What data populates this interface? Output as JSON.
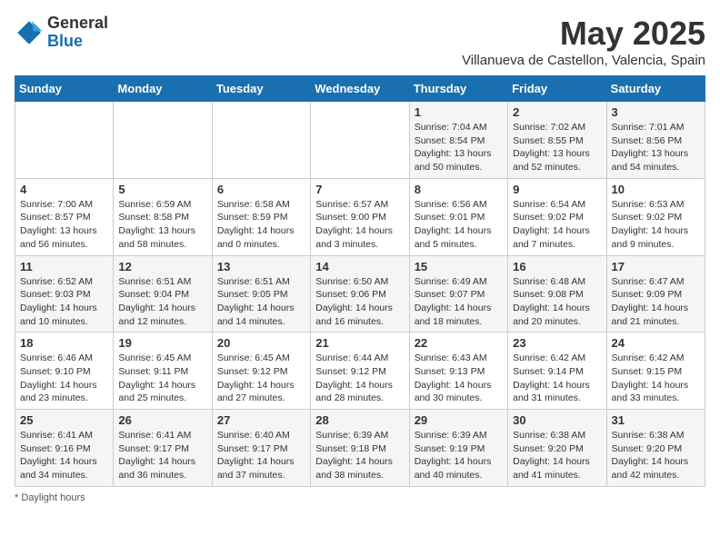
{
  "header": {
    "logo_general": "General",
    "logo_blue": "Blue",
    "month_title": "May 2025",
    "subtitle": "Villanueva de Castellon, Valencia, Spain"
  },
  "days_of_week": [
    "Sunday",
    "Monday",
    "Tuesday",
    "Wednesday",
    "Thursday",
    "Friday",
    "Saturday"
  ],
  "footer": {
    "note": "Daylight hours"
  },
  "weeks": [
    [
      {
        "day": "",
        "info": ""
      },
      {
        "day": "",
        "info": ""
      },
      {
        "day": "",
        "info": ""
      },
      {
        "day": "",
        "info": ""
      },
      {
        "day": "1",
        "info": "Sunrise: 7:04 AM\nSunset: 8:54 PM\nDaylight: 13 hours\nand 50 minutes."
      },
      {
        "day": "2",
        "info": "Sunrise: 7:02 AM\nSunset: 8:55 PM\nDaylight: 13 hours\nand 52 minutes."
      },
      {
        "day": "3",
        "info": "Sunrise: 7:01 AM\nSunset: 8:56 PM\nDaylight: 13 hours\nand 54 minutes."
      }
    ],
    [
      {
        "day": "4",
        "info": "Sunrise: 7:00 AM\nSunset: 8:57 PM\nDaylight: 13 hours\nand 56 minutes."
      },
      {
        "day": "5",
        "info": "Sunrise: 6:59 AM\nSunset: 8:58 PM\nDaylight: 13 hours\nand 58 minutes."
      },
      {
        "day": "6",
        "info": "Sunrise: 6:58 AM\nSunset: 8:59 PM\nDaylight: 14 hours\nand 0 minutes."
      },
      {
        "day": "7",
        "info": "Sunrise: 6:57 AM\nSunset: 9:00 PM\nDaylight: 14 hours\nand 3 minutes."
      },
      {
        "day": "8",
        "info": "Sunrise: 6:56 AM\nSunset: 9:01 PM\nDaylight: 14 hours\nand 5 minutes."
      },
      {
        "day": "9",
        "info": "Sunrise: 6:54 AM\nSunset: 9:02 PM\nDaylight: 14 hours\nand 7 minutes."
      },
      {
        "day": "10",
        "info": "Sunrise: 6:53 AM\nSunset: 9:02 PM\nDaylight: 14 hours\nand 9 minutes."
      }
    ],
    [
      {
        "day": "11",
        "info": "Sunrise: 6:52 AM\nSunset: 9:03 PM\nDaylight: 14 hours\nand 10 minutes."
      },
      {
        "day": "12",
        "info": "Sunrise: 6:51 AM\nSunset: 9:04 PM\nDaylight: 14 hours\nand 12 minutes."
      },
      {
        "day": "13",
        "info": "Sunrise: 6:51 AM\nSunset: 9:05 PM\nDaylight: 14 hours\nand 14 minutes."
      },
      {
        "day": "14",
        "info": "Sunrise: 6:50 AM\nSunset: 9:06 PM\nDaylight: 14 hours\nand 16 minutes."
      },
      {
        "day": "15",
        "info": "Sunrise: 6:49 AM\nSunset: 9:07 PM\nDaylight: 14 hours\nand 18 minutes."
      },
      {
        "day": "16",
        "info": "Sunrise: 6:48 AM\nSunset: 9:08 PM\nDaylight: 14 hours\nand 20 minutes."
      },
      {
        "day": "17",
        "info": "Sunrise: 6:47 AM\nSunset: 9:09 PM\nDaylight: 14 hours\nand 21 minutes."
      }
    ],
    [
      {
        "day": "18",
        "info": "Sunrise: 6:46 AM\nSunset: 9:10 PM\nDaylight: 14 hours\nand 23 minutes."
      },
      {
        "day": "19",
        "info": "Sunrise: 6:45 AM\nSunset: 9:11 PM\nDaylight: 14 hours\nand 25 minutes."
      },
      {
        "day": "20",
        "info": "Sunrise: 6:45 AM\nSunset: 9:12 PM\nDaylight: 14 hours\nand 27 minutes."
      },
      {
        "day": "21",
        "info": "Sunrise: 6:44 AM\nSunset: 9:12 PM\nDaylight: 14 hours\nand 28 minutes."
      },
      {
        "day": "22",
        "info": "Sunrise: 6:43 AM\nSunset: 9:13 PM\nDaylight: 14 hours\nand 30 minutes."
      },
      {
        "day": "23",
        "info": "Sunrise: 6:42 AM\nSunset: 9:14 PM\nDaylight: 14 hours\nand 31 minutes."
      },
      {
        "day": "24",
        "info": "Sunrise: 6:42 AM\nSunset: 9:15 PM\nDaylight: 14 hours\nand 33 minutes."
      }
    ],
    [
      {
        "day": "25",
        "info": "Sunrise: 6:41 AM\nSunset: 9:16 PM\nDaylight: 14 hours\nand 34 minutes."
      },
      {
        "day": "26",
        "info": "Sunrise: 6:41 AM\nSunset: 9:17 PM\nDaylight: 14 hours\nand 36 minutes."
      },
      {
        "day": "27",
        "info": "Sunrise: 6:40 AM\nSunset: 9:17 PM\nDaylight: 14 hours\nand 37 minutes."
      },
      {
        "day": "28",
        "info": "Sunrise: 6:39 AM\nSunset: 9:18 PM\nDaylight: 14 hours\nand 38 minutes."
      },
      {
        "day": "29",
        "info": "Sunrise: 6:39 AM\nSunset: 9:19 PM\nDaylight: 14 hours\nand 40 minutes."
      },
      {
        "day": "30",
        "info": "Sunrise: 6:38 AM\nSunset: 9:20 PM\nDaylight: 14 hours\nand 41 minutes."
      },
      {
        "day": "31",
        "info": "Sunrise: 6:38 AM\nSunset: 9:20 PM\nDaylight: 14 hours\nand 42 minutes."
      }
    ]
  ]
}
